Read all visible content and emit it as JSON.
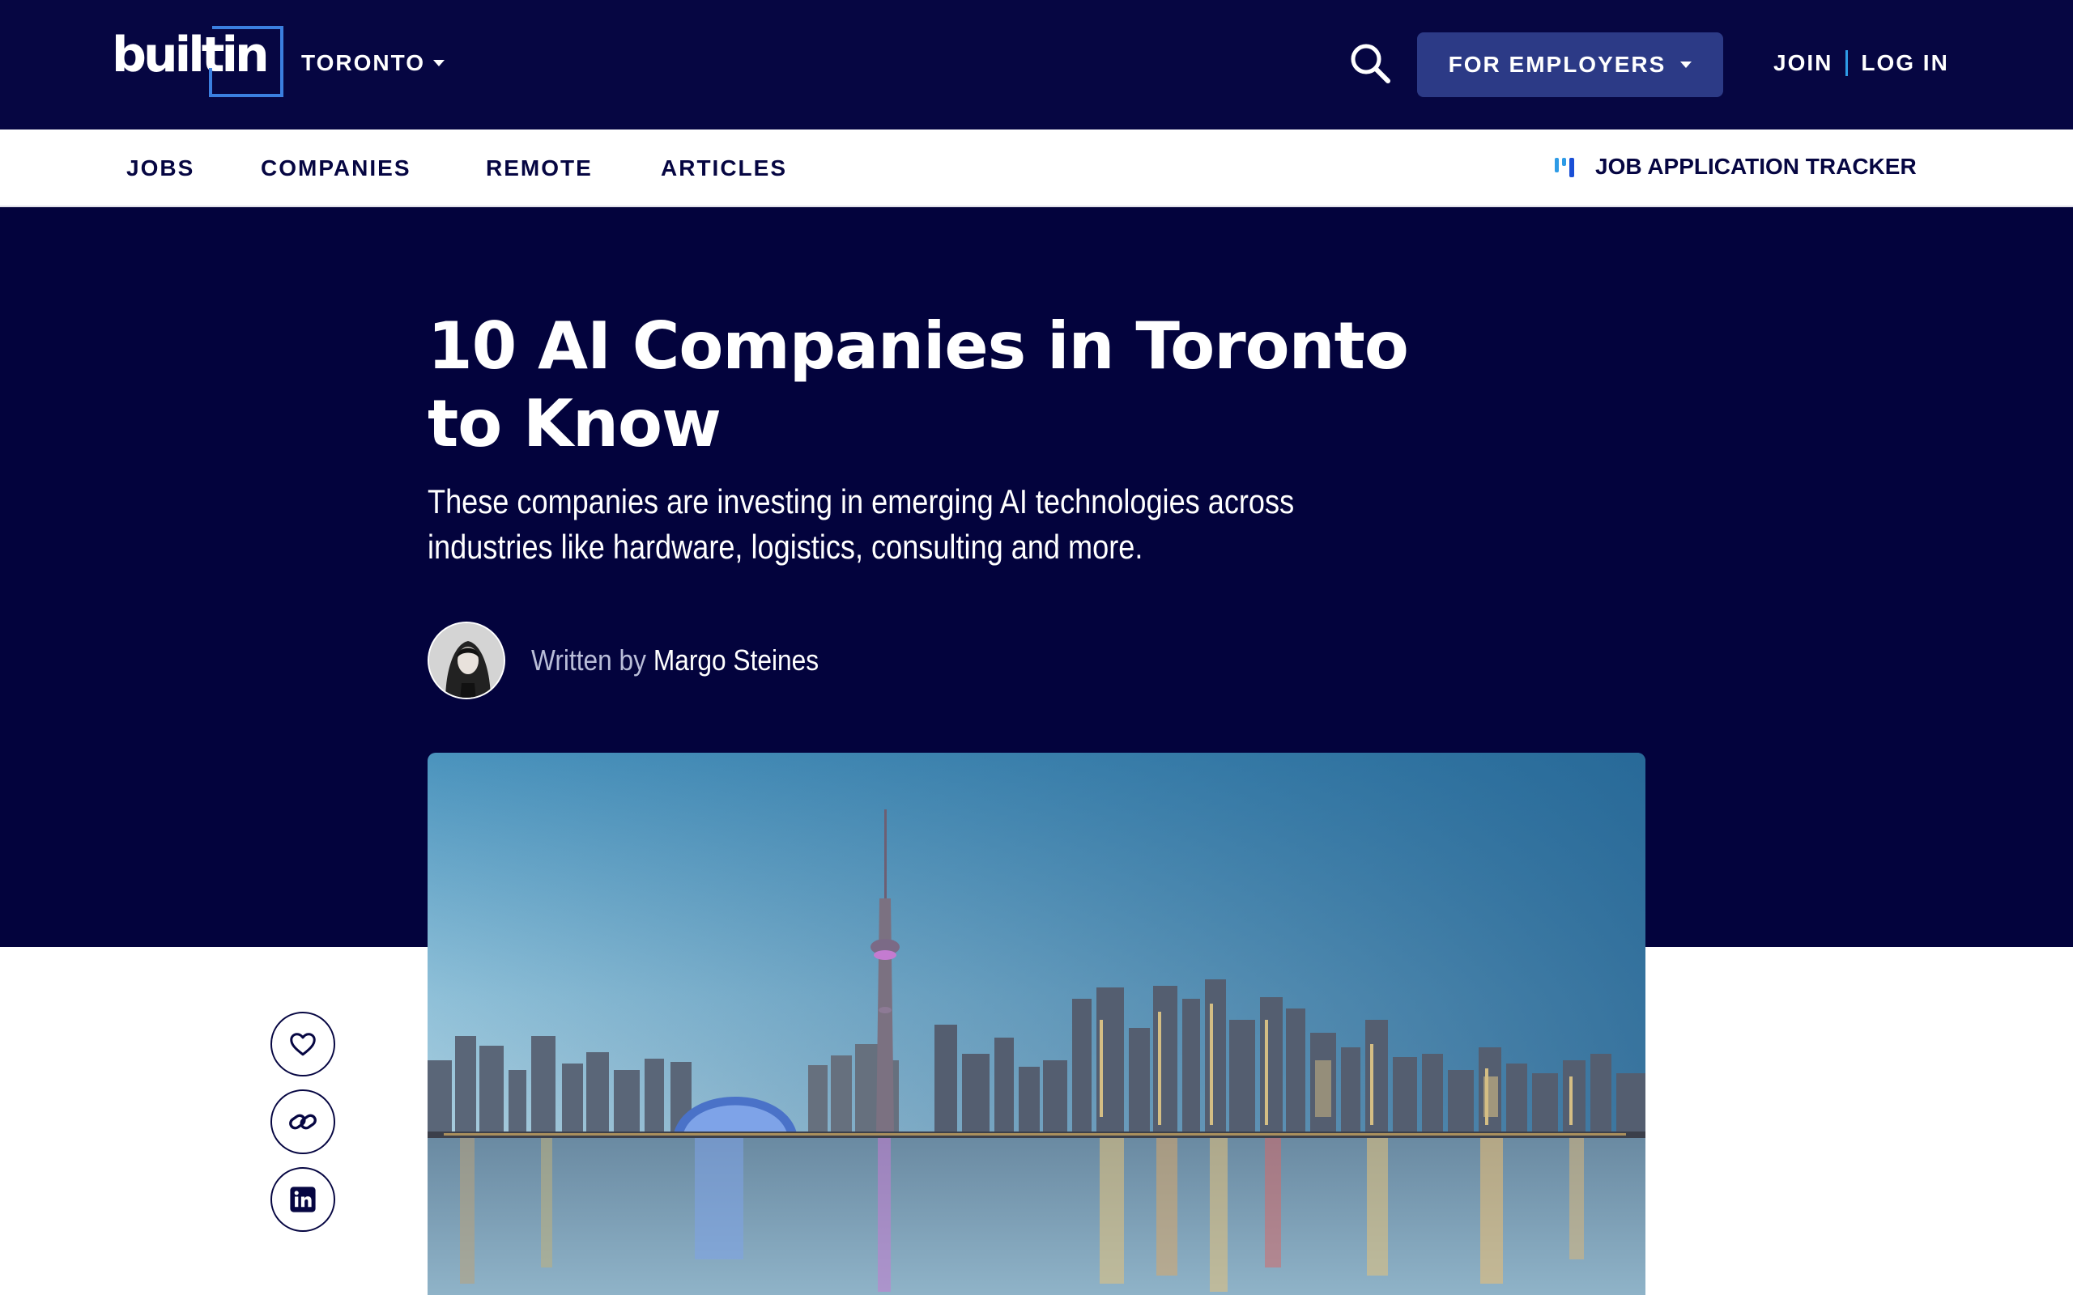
{
  "header": {
    "brand": "builtin",
    "city": "TORONTO",
    "for_employers": "FOR EMPLOYERS",
    "join": "JOIN",
    "login": "LOG IN"
  },
  "nav": {
    "items": [
      "JOBS",
      "COMPANIES",
      "REMOTE",
      "ARTICLES"
    ],
    "tracker": "JOB APPLICATION TRACKER"
  },
  "article": {
    "title": "10 AI Companies in Toronto to Know",
    "subtitle": "These companies are investing in emerging AI technologies across industries like hardware, logistics, consulting and more.",
    "written_by": "Written by",
    "author": "Margo Steines"
  },
  "share": {
    "icons": [
      "heart-icon",
      "link-icon",
      "linkedin-icon"
    ]
  },
  "colors": {
    "header_bg": "#060642",
    "hero_bg": "#03033d",
    "employers_button": "#2c3a86",
    "accent_blue": "#2e9be6"
  }
}
